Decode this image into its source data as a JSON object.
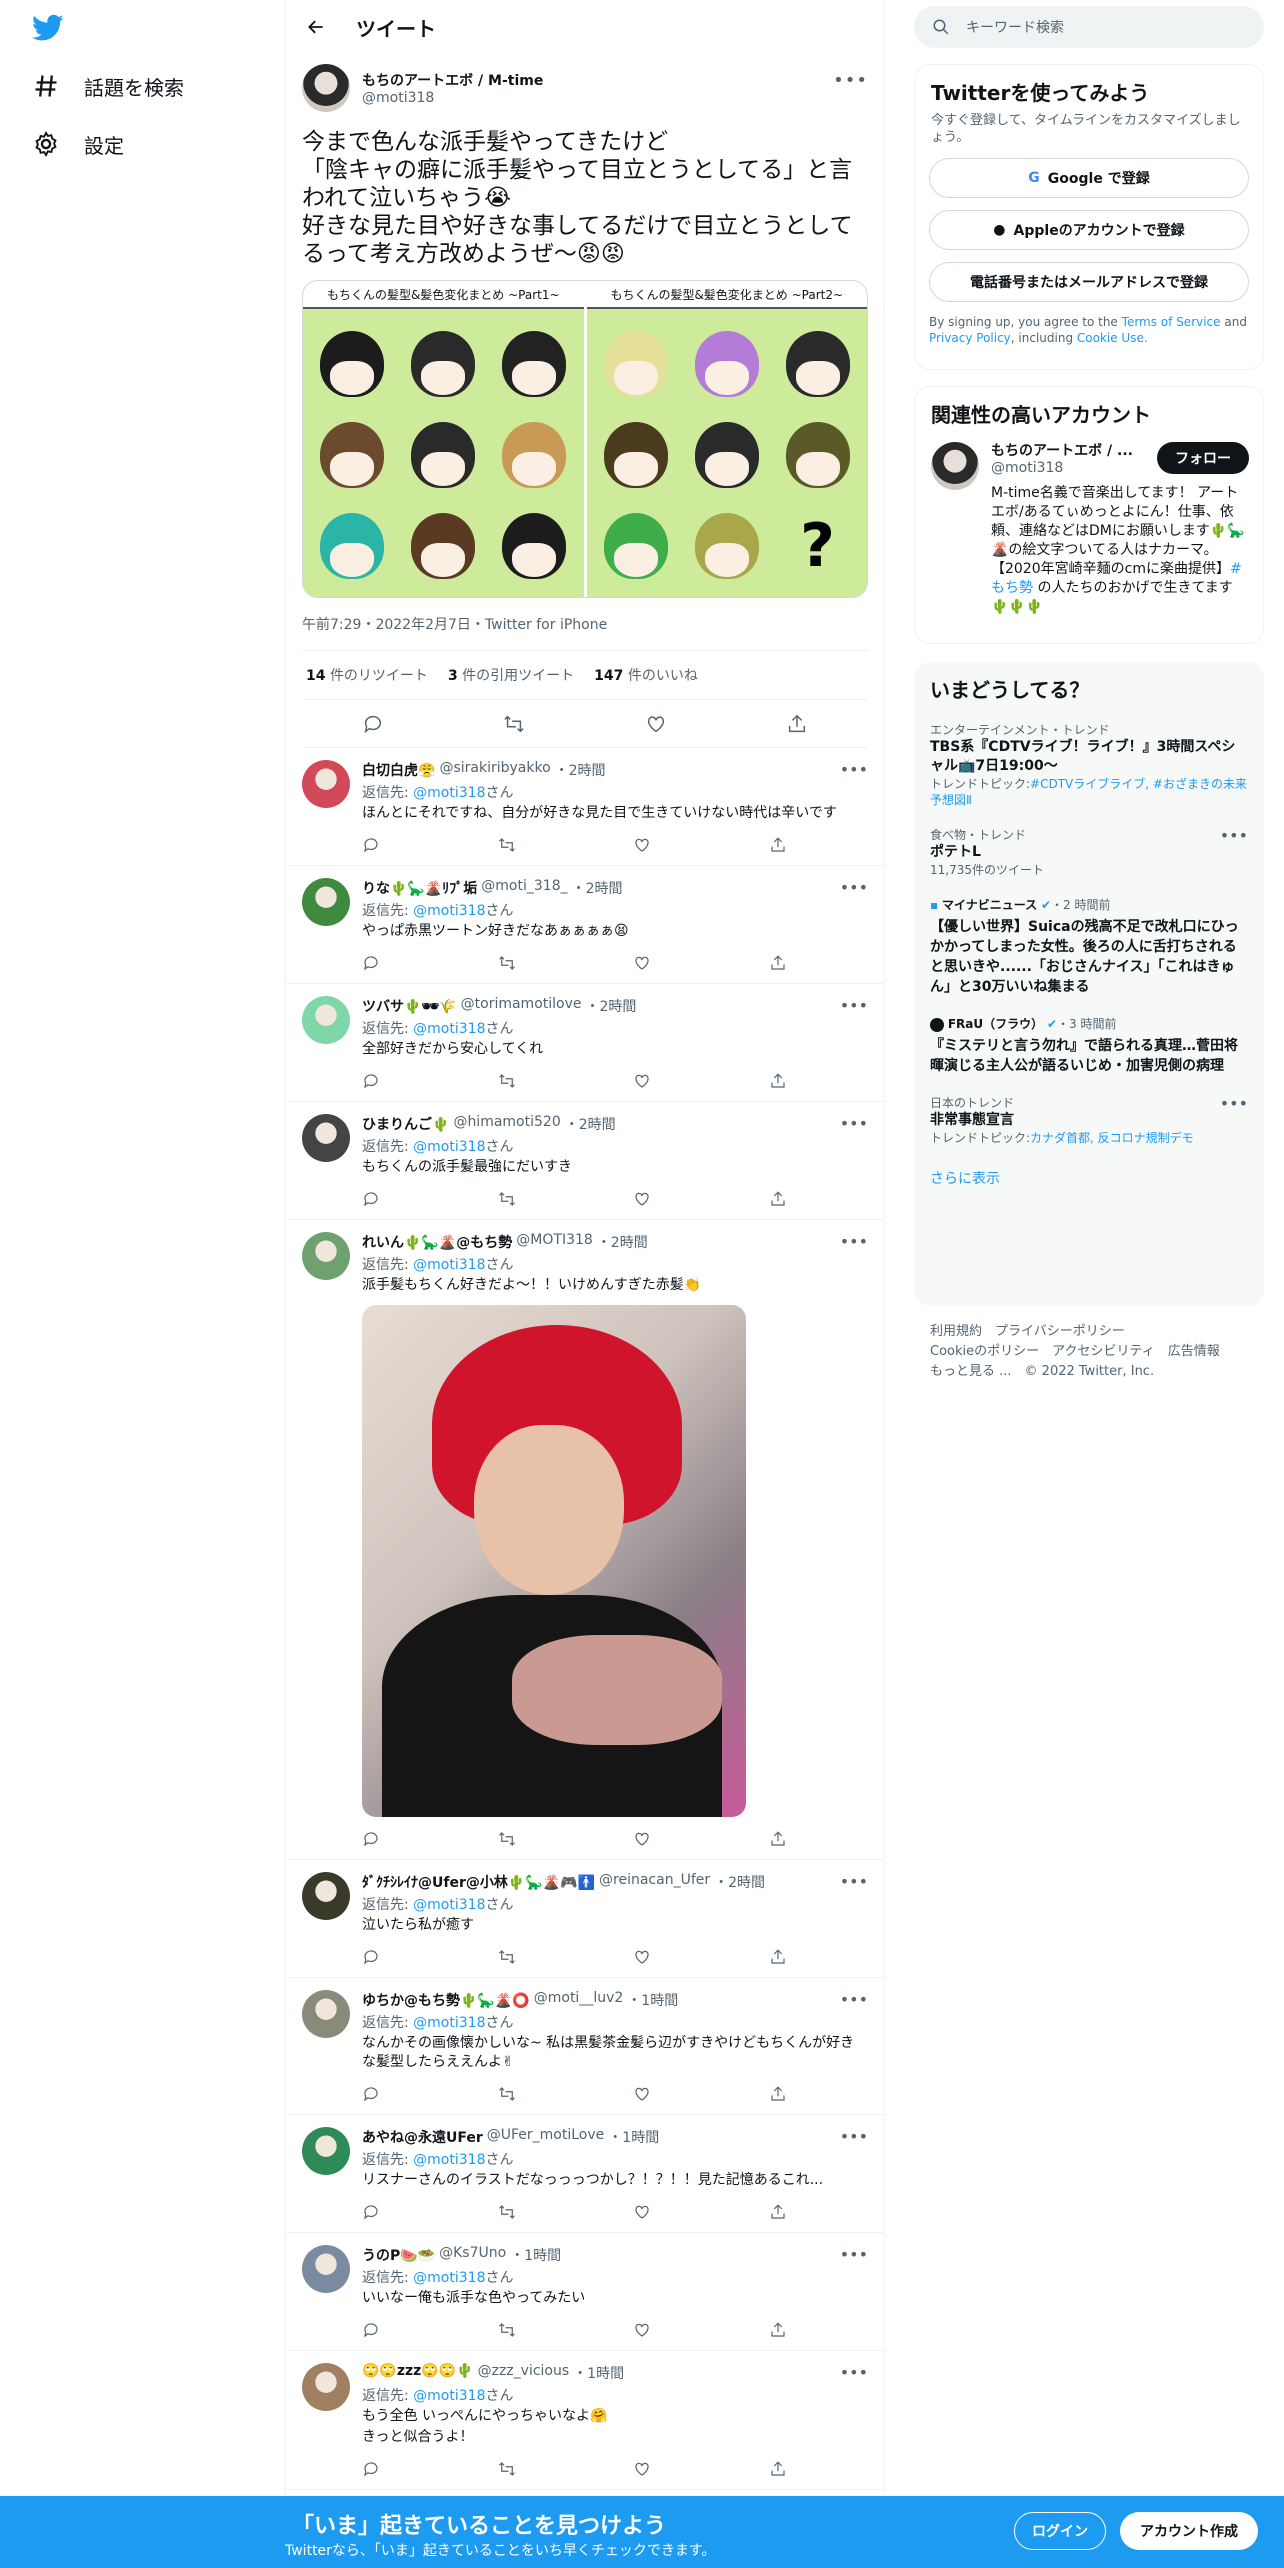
{
  "nav": {
    "explore_label": "話題を検索",
    "settings_label": "設定"
  },
  "header": {
    "title": "ツイート"
  },
  "tweet": {
    "display_name": "もちのアートエボ / M-time",
    "username": "@moti318",
    "text": "今まで色んな派手髪やってきたけど\n「陰キャの癖に派手髪やって目立とうとしてる」と言われて泣いちゃう😭\n好きな見た目や好きな事してるだけで目立とうとしてるって考え方改めようぜ〜😡😡",
    "media_header_left": "もちくんの髪型&髪色変化まとめ ~Part1~",
    "media_header_right": "もちくんの髪型&髪色変化まとめ ~Part2~",
    "media_qmark": "?",
    "timestamp": "午前7:29・2022年2月7日・Twitter for iPhone",
    "retweets_count": "14",
    "retweets_label": "件のリツイート",
    "quotes_count": "3",
    "quotes_label": "件の引用ツイート",
    "likes_count": "147",
    "likes_label": "件のいいね"
  },
  "reply_to_prefix": "返信先:",
  "reply_to_handle": "@moti318",
  "reply_to_suffix": "さん",
  "replies": [
    {
      "display_name": "白切白虎😤",
      "username": "@sirakiribyakko",
      "time": "・2時間",
      "text": "ほんとにそれですね、自分が好きな見た目で生きていけない時代は辛いです",
      "color": "#d24a5a"
    },
    {
      "display_name": "りな🌵🦕🌋ﾘﾌﾟ垢",
      "username": "@moti_318_",
      "time": "・2時間",
      "text": "やっぱ赤黒ツートン好きだなあぁぁぁぁ😫",
      "color": "#3f8a3f"
    },
    {
      "display_name": "ツバサ🌵🕶🌾",
      "username": "@torimamotilove",
      "time": "・2時間",
      "text": "全部好きだから安心してくれ",
      "color": "#7fd6a8"
    },
    {
      "display_name": "ひまりんご🌵",
      "username": "@himamoti520",
      "time": "・2時間",
      "text": "もちくんの派手髪最強にだいすき",
      "color": "#444444"
    },
    {
      "display_name": "れいん🌵🦕🌋@もち勢",
      "username": "@MOTI318",
      "time": "・2時間",
      "text": "派手髪もちくん好きだよ〜！！いけめんすぎた赤髪👏",
      "color": "#6fa06f"
    },
    {
      "display_name": "ﾀﾞｸﾁｼﾚｲﾅ@Ufer@小林🌵🦕🌋🎮🚹",
      "username": "@reinacan_Ufer",
      "time": "・2時間",
      "text": "泣いたら私が癒す",
      "color": "#3a3a2a"
    },
    {
      "display_name": "ゆちか@もち勢🌵🦕🌋⭕",
      "username": "@moti__luv2",
      "time": "・1時間",
      "text": "なんかその画像懐かしいな~ 私は黒髪茶金髪ら辺がすきやけどもちくんが好きな髪型したらええんよ✌",
      "color": "#8a8a7a"
    },
    {
      "display_name": "あやね@永遠UFer",
      "username": "@UFer_motiLove",
      "time": "・1時間",
      "text": "リスナーさんのイラストだなっっっつかし？！？！！見た記憶あるこれ...",
      "color": "#2e8b57"
    },
    {
      "display_name": "うのP🍉🥗",
      "username": "@Ks7Uno",
      "time": "・1時間",
      "text": "いいなー俺も派手な色やってみたい",
      "color": "#7a8aa0"
    },
    {
      "display_name": "🙄🙄zzz🙄🙄🌵",
      "username": "@zzz_vicious",
      "time": "・1時間",
      "text": "もう全色 いっぺんにやっちゃいなよ🤗",
      "text2": "きっと似合うよ！",
      "color": "#a08060"
    }
  ],
  "search": {
    "placeholder": "キーワード検索"
  },
  "signup_panel": {
    "title": "Twitterを使ってみよう",
    "desc": "今すぐ登録して、タイムラインをカスタマイズしましょう。",
    "google_label": "Google で登録",
    "apple_label": "Appleのアカウントで登録",
    "phone_label": "電話番号またはメールアドレスで登録",
    "legal_pre": "By signing up, you agree to the",
    "terms": "Terms of Service",
    "and": "and",
    "privacy": "Privacy Policy",
    "including": ", including",
    "cookie": "Cookie Use."
  },
  "relevant": {
    "title": "関連性の高いアカウント",
    "display_name": "もちのアートエボ / ...",
    "username": "@moti318",
    "follow_label": "フォロー",
    "bio": "M-time名義で音楽出してます！ アートエボ/あるてぃめっとよにん！仕事、依頼、連絡などはDMにお願いします🌵🦕🌋の絵文字ついてる人はナカーマ。【2020年宮崎辛麺のcmに楽曲提供】",
    "bio_tag": "#もち勢",
    "bio_end": " の人たちのおかげで生きてます🌵🌵🌵"
  },
  "trends": {
    "title": "いまどうしてる？",
    "t1_meta": "エンターテインメント・トレンド",
    "t1_name": "TBS系『CDTVライブ！ライブ！』3時間スペシャル📺7日19:00〜",
    "t1_sub_pre": "トレンドトピック:",
    "t1_sub_link": "#CDTVライブライブ, #おざまきの未来予想図Ⅱ",
    "t2_meta": "食べ物・トレンド",
    "t2_name": "ポテトL",
    "t2_sub": "11,735件のツイート",
    "t3_source": "マイナビニュース",
    "t3_time": "・2 時間前",
    "t3_name": "【優しい世界】Suicaの残高不足で改札口にひっかかってしまった女性。後ろの人に舌打ちされると思いきや......「おじさんナイス」「これはきゅん」と30万いいね集まる",
    "t4_source": "FRaU（フラウ）",
    "t4_time": "・3 時間前",
    "t4_name": "『ミステリと言う勿れ』で語られる真理…菅田将暉演じる主人公が語るいじめ・加害児側の病理",
    "t5_meta": "日本のトレンド",
    "t5_name": "非常事態宣言",
    "t5_sub_pre": "トレンドトピック:",
    "t5_sub_link": "カナダ首都, 反コロナ規制デモ",
    "show_more": "さらに表示"
  },
  "footer": {
    "l1": "利用規約",
    "l2": "プライバシーポリシー",
    "l3": "Cookieのポリシー",
    "l4": "アクセシビリティ",
    "l5": "広告情報",
    "l6": "もっと見る ...",
    "l7": "© 2022 Twitter, Inc."
  },
  "bottom_bar": {
    "title": "「いま」起きていることを見つけよう",
    "sub": "Twitterなら、「いま」起きていることをいち早くチェックできます。",
    "login": "ログイン",
    "signup": "アカウント作成"
  },
  "colors": {
    "accent": "#1d9bf0",
    "text": "#0f1419",
    "muted": "#536471"
  },
  "media_hair_colors": {
    "left": [
      "#1c1c1c",
      "#2a2a2a",
      "#222222",
      "#6b4a2e",
      "#2a2a2a",
      "#c99a55",
      "#2bb5a6",
      "#5a3a22",
      "#1c1c1c"
    ],
    "right": [
      "#e6e19a",
      "#b47cd6",
      "#2a2a2a",
      "#4a3a1e",
      "#2a2a2a",
      "#5a5a28",
      "#3fae4a",
      "#a8a84a",
      "none"
    ]
  }
}
